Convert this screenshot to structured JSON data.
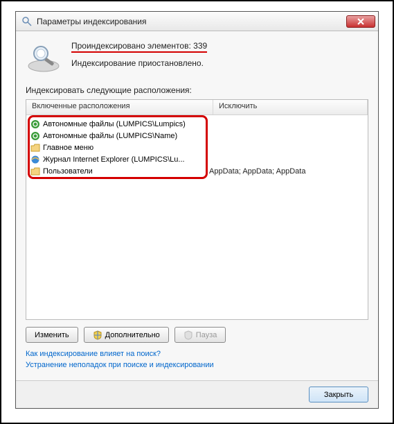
{
  "titlebar": {
    "title": "Параметры индексирования"
  },
  "header": {
    "indexed_prefix": "Проиндексировано элементов: ",
    "indexed_count": "339",
    "status": "Индексирование приостановлено."
  },
  "locations_label": "Индексировать следующие расположения:",
  "columns": {
    "included": "Включенные расположения",
    "exclude": "Исключить"
  },
  "rows": [
    {
      "icon": "sync",
      "label": "Автономные файлы (LUMPICS\\Lumpics)",
      "exclude": ""
    },
    {
      "icon": "sync",
      "label": "Автономные файлы (LUMPICS\\Name)",
      "exclude": ""
    },
    {
      "icon": "folder",
      "label": "Главное меню",
      "exclude": ""
    },
    {
      "icon": "ie",
      "label": "Журнал Internet Explorer (LUMPICS\\Lu...",
      "exclude": ""
    },
    {
      "icon": "folder",
      "label": "Пользователи",
      "exclude": "AppData; AppData; AppData"
    }
  ],
  "buttons": {
    "modify": "Изменить",
    "advanced": "Дополнительно",
    "pause": "Пауза",
    "close": "Закрыть"
  },
  "links": {
    "how_affects": "Как индексирование влияет на поиск?",
    "troubleshoot": "Устранение неполадок при поиске и индексировании"
  }
}
